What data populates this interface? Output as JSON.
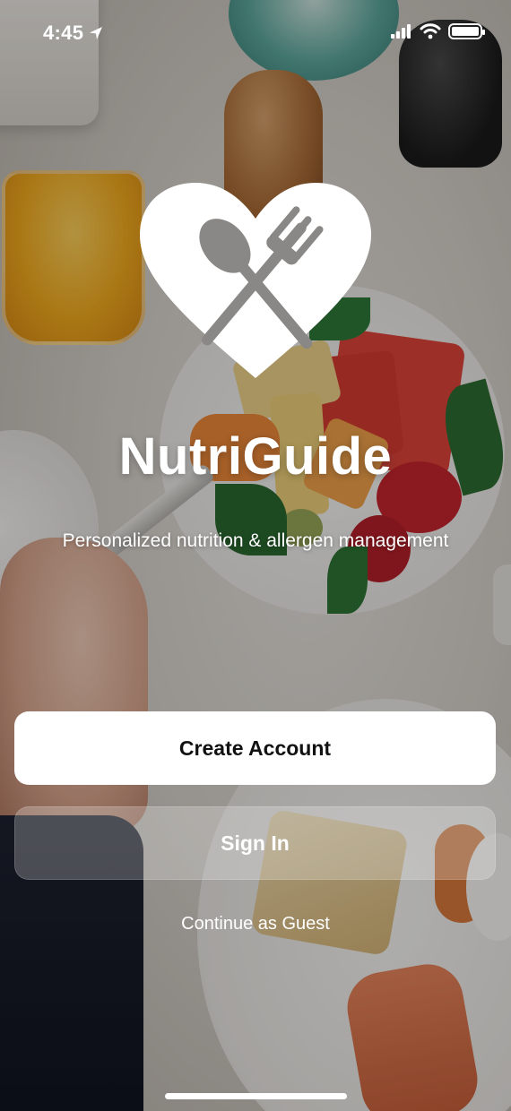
{
  "status_bar": {
    "time": "4:45",
    "icons": [
      "location-arrow-icon",
      "cellular-signal-icon",
      "wifi-icon",
      "battery-icon"
    ]
  },
  "app": {
    "name": "NutriGuide",
    "tagline": "Personalized nutrition & allergen management",
    "logo_icon": "heart-fork-spoon-icon"
  },
  "actions": {
    "create_account": "Create Account",
    "sign_in": "Sign In",
    "continue_guest": "Continue as Guest"
  },
  "colors": {
    "primary_button_bg": "#ffffff",
    "primary_button_text": "#111111",
    "secondary_button_bg": "rgba(255,255,255,0.24)",
    "text": "#ffffff"
  }
}
